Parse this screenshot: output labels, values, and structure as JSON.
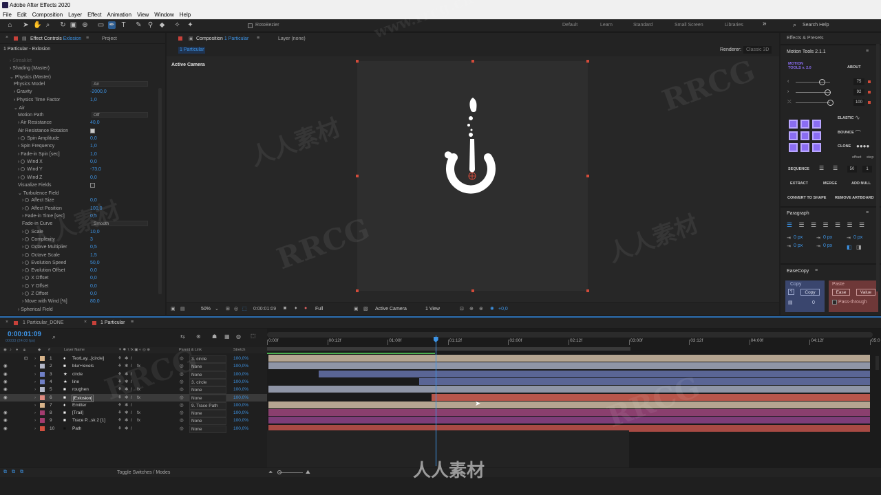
{
  "app": {
    "title": "Adobe After Effects 2020"
  },
  "menu": [
    "File",
    "Edit",
    "Composition",
    "Layer",
    "Effect",
    "Animation",
    "View",
    "Window",
    "Help"
  ],
  "toolbar": {
    "roto_bezier": "RotoBezier",
    "workspaces": [
      "Default",
      "Learn",
      "Standard",
      "Small Screen",
      "Libraries"
    ],
    "search_placeholder": "Search Help",
    "more": "»"
  },
  "effect_controls": {
    "tab_prefix": "Effect Controls",
    "tab_layer": "Exlosion",
    "project_tab": "Project",
    "header": "1 Particular - Exlosion",
    "rows": [
      {
        "label": "Streaklet",
        "indent": 0,
        "tw": "closed",
        "value": "",
        "dim": true
      },
      {
        "label": "Shading (Master)",
        "indent": 0,
        "tw": "closed",
        "value": ""
      },
      {
        "label": "Physics (Master)",
        "indent": 0,
        "tw": "open",
        "value": ""
      },
      {
        "label": "Physics Model",
        "indent": 1,
        "tw": "",
        "value": "Air",
        "type": "select"
      },
      {
        "label": "Gravity",
        "indent": 1,
        "tw": "closed",
        "value": "-2000,0",
        "stop": false
      },
      {
        "label": "Physics Time Factor",
        "indent": 1,
        "tw": "closed",
        "value": "1,0",
        "stop": false
      },
      {
        "label": "Air",
        "indent": 1,
        "tw": "open",
        "value": ""
      },
      {
        "label": "Motion Path",
        "indent": 2,
        "tw": "",
        "value": "Off",
        "type": "select"
      },
      {
        "label": "Air Resistance",
        "indent": 2,
        "tw": "closed",
        "value": "40,0"
      },
      {
        "label": "Air Resistance Rotation",
        "indent": 2,
        "tw": "",
        "value": "",
        "type": "check",
        "checked": true
      },
      {
        "label": "Spin Amplitude",
        "indent": 2,
        "tw": "closed",
        "value": "0,0",
        "stop": true
      },
      {
        "label": "Spin Frequency",
        "indent": 2,
        "tw": "closed",
        "value": "1,0"
      },
      {
        "label": "Fade-in Spin [sec]",
        "indent": 2,
        "tw": "closed",
        "value": "1,0"
      },
      {
        "label": "Wind X",
        "indent": 2,
        "tw": "closed",
        "value": "0,0",
        "stop": true
      },
      {
        "label": "Wind Y",
        "indent": 2,
        "tw": "closed",
        "value": "-73,0",
        "stop": true
      },
      {
        "label": "Wind Z",
        "indent": 2,
        "tw": "closed",
        "value": "0,0",
        "stop": true
      },
      {
        "label": "Visualize Fields",
        "indent": 2,
        "tw": "",
        "value": "",
        "type": "check",
        "checked": false
      },
      {
        "label": "Turbulence Field",
        "indent": 2,
        "tw": "open",
        "value": ""
      },
      {
        "label": "Affect Size",
        "indent": 3,
        "tw": "closed",
        "value": "0,0",
        "stop": true
      },
      {
        "label": "Affect Position",
        "indent": 3,
        "tw": "closed",
        "value": "100,0",
        "stop": true
      },
      {
        "label": "Fade-in Time [sec]",
        "indent": 3,
        "tw": "closed",
        "value": "0,5"
      },
      {
        "label": "Fade-in Curve",
        "indent": 3,
        "tw": "",
        "value": "Smooth",
        "type": "select"
      },
      {
        "label": "Scale",
        "indent": 3,
        "tw": "closed",
        "value": "10,0",
        "stop": true
      },
      {
        "label": "Complexity",
        "indent": 3,
        "tw": "closed",
        "value": "3",
        "stop": true
      },
      {
        "label": "Octave Multiplier",
        "indent": 3,
        "tw": "closed",
        "value": "0,5",
        "stop": true
      },
      {
        "label": "Octave Scale",
        "indent": 3,
        "tw": "closed",
        "value": "1,5",
        "stop": true
      },
      {
        "label": "Evolution Speed",
        "indent": 3,
        "tw": "closed",
        "value": "50,0",
        "stop": true
      },
      {
        "label": "Evolution Offset",
        "indent": 3,
        "tw": "closed",
        "value": "0,0",
        "stop": true
      },
      {
        "label": "X Offset",
        "indent": 3,
        "tw": "closed",
        "value": "0,0",
        "stop": true
      },
      {
        "label": "Y Offset",
        "indent": 3,
        "tw": "closed",
        "value": "0,0",
        "stop": true
      },
      {
        "label": "Z Offset",
        "indent": 3,
        "tw": "closed",
        "value": "0,0",
        "stop": true
      },
      {
        "label": "Move with Wind [%]",
        "indent": 3,
        "tw": "closed",
        "value": "80,0"
      },
      {
        "label": "Spherical Field",
        "indent": 2,
        "tw": "closed",
        "value": ""
      }
    ]
  },
  "composition": {
    "tab_prefix": "Composition",
    "tab_name": "1 Particular",
    "layer_tab": "Layer (none)",
    "breadcrumb": "1 Particular",
    "renderer_label": "Renderer:",
    "renderer_value": "Classic 3D",
    "camera_label": "Active Camera"
  },
  "viewer_bar": {
    "zoom": "50%",
    "timecode": "0:00:01:09",
    "resolution": "Full",
    "camera": "Active Camera",
    "views": "1 View",
    "exposure": "+0,0"
  },
  "right_panel": {
    "effects_presets": "Effects & Presets",
    "motion_tools_tab": "Motion Tools 2.1.1",
    "motion_tools_logo": "MOTION TOOLS v. 2.0",
    "about": "ABOUT",
    "slider_values": [
      "75",
      "92",
      "100"
    ],
    "elastic": "ELASTIC",
    "bounce": "BOUNCE",
    "clone": "CLONE",
    "offset": "offset",
    "step": "step",
    "sequence": "SEQUENCE",
    "sequence_value": "50",
    "sequence_step": "1",
    "extract": "EXTRACT",
    "merge": "MERGE",
    "add_null": "ADD NULL",
    "convert_to_shape": "CONVERT TO SHAPE",
    "remove_artboard": "REMOVE ARTBOARD",
    "paragraph": "Paragraph",
    "para_values": [
      "0 px",
      "0 px",
      "0 px",
      "0 px",
      "0 px"
    ],
    "easecopy": "EaseCopy",
    "copy_label": "Copy",
    "copy_btn": "Copy",
    "copy_count": "0",
    "paste_label": "Paste",
    "ease_btn": "Ease",
    "value_btn": "Value",
    "pass_through": "Pass-through"
  },
  "timeline": {
    "tabs": [
      "1 Particular_DONE",
      "1 Particular"
    ],
    "timecode": "0:00:01:09",
    "frame_info": "00033 (24.00 fps)",
    "columns": {
      "num": "#",
      "layer_name": "Layer Name",
      "parent": "Parent & Link",
      "stretch": "Stretch"
    },
    "ruler": [
      "0:00f",
      "00:12f",
      "01:00f",
      "01:12f",
      "02:00f",
      "02:12f",
      "03:00f",
      "03:12f",
      "04:00f",
      "04:12f",
      "05:0"
    ],
    "layers": [
      {
        "num": "1",
        "name": "TextLay...[circle]",
        "icon": "light",
        "label_color": "#d8b48a",
        "parent": "3. circle",
        "stretch": "100,0%",
        "bar_color": "#b5a591",
        "bar_start": 0.0,
        "bar_end": 1.0,
        "eye": false,
        "lock": true
      },
      {
        "num": "2",
        "name": "blur+levels",
        "icon": "solid",
        "label_color": "#b3b7c8",
        "parent": "None",
        "stretch": "100,0%",
        "bar_color": "#8f95a6",
        "bar_start": 0.0,
        "bar_end": 1.0,
        "eye": true,
        "fx": true
      },
      {
        "num": "3",
        "name": "circle",
        "icon": "star",
        "label_color": "#6f7fc6",
        "parent": "None",
        "stretch": "100,0%",
        "bar_color": "#5a6595",
        "bar_start": 0.083,
        "bar_end": 1.0,
        "eye": true
      },
      {
        "num": "4",
        "name": "line",
        "icon": "star",
        "label_color": "#6f7fc6",
        "parent": "3. circle",
        "stretch": "100,0%",
        "bar_color": "#5a6595",
        "bar_start": 0.25,
        "bar_end": 1.0,
        "eye": true
      },
      {
        "num": "5",
        "name": "roughen",
        "icon": "solid",
        "label_color": "#b3b7c8",
        "parent": "None",
        "stretch": "100,0%",
        "bar_color": "#8f95a6",
        "bar_start": 0.0,
        "bar_end": 1.0,
        "eye": true,
        "fx": true
      },
      {
        "num": "6",
        "name": "[Exlosion]",
        "icon": "solid",
        "label_color": "#e08a80",
        "parent": "None",
        "stretch": "100,0%",
        "bar_color": "#b8564b",
        "bar_start": 0.27,
        "bar_end": 1.0,
        "eye": true,
        "fx": true,
        "selected": true
      },
      {
        "num": "7",
        "name": "Emitter",
        "icon": "light",
        "label_color": "#d8b48a",
        "parent": "9. Trace Path",
        "stretch": "100,0%",
        "bar_color": "#b5a591",
        "bar_start": 0.0,
        "bar_end": 1.0,
        "eye": false
      },
      {
        "num": "8",
        "name": "[Trail]",
        "icon": "solid",
        "label_color": "#a43c6f",
        "parent": "None",
        "stretch": "100,0%",
        "bar_color": "#8a3f6e",
        "bar_start": 0.0,
        "bar_end": 1.0,
        "eye": true,
        "fx": true
      },
      {
        "num": "9",
        "name": "Trace P...sk 2 [1]",
        "icon": "solid",
        "label_color": "#a43c6f",
        "parent": "None",
        "stretch": "100,0%",
        "bar_color": "#7d3d78",
        "bar_start": 0.0,
        "bar_end": 1.0,
        "eye": true,
        "fx": true
      },
      {
        "num": "10",
        "name": "Path",
        "icon": "solid-dark",
        "label_color": "#d1503f",
        "parent": "None",
        "stretch": "100,0%",
        "bar_color": "#a84a44",
        "bar_start": 0.0,
        "bar_end": 1.0,
        "eye": true
      }
    ],
    "footer_toggle": "Toggle Switches / Modes",
    "playhead": 0.277,
    "work_area_end": 0.6
  },
  "watermarks": [
    "www.rrcg.cn",
    "人人素材",
    "RRCG"
  ],
  "colors": {
    "accent": "#3d94e6",
    "panel": "#232323",
    "viewer": "#272727",
    "comp": "#2e2e2e"
  }
}
